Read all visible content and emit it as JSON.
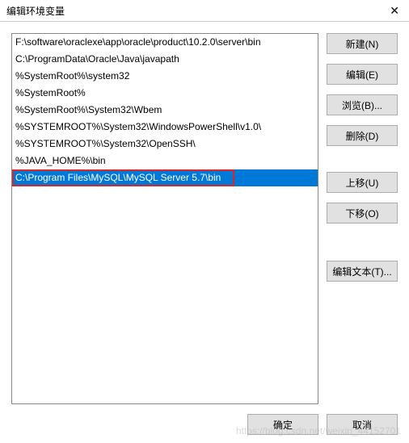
{
  "title": "编辑环境变量",
  "list": {
    "items": [
      "F:\\software\\oraclexe\\app\\oracle\\product\\10.2.0\\server\\bin",
      "C:\\ProgramData\\Oracle\\Java\\javapath",
      "%SystemRoot%\\system32",
      "%SystemRoot%",
      "%SystemRoot%\\System32\\Wbem",
      "%SYSTEMROOT%\\System32\\WindowsPowerShell\\v1.0\\",
      "%SYSTEMROOT%\\System32\\OpenSSH\\",
      "%JAVA_HOME%\\bin",
      "C:\\Program Files\\MySQL\\MySQL Server 5.7\\bin"
    ],
    "selected_index": 8,
    "highlighted_index": 8
  },
  "buttons": {
    "new": "新建(N)",
    "edit": "编辑(E)",
    "browse": "浏览(B)...",
    "delete": "删除(D)",
    "move_up": "上移(U)",
    "move_down": "下移(O)",
    "edit_text": "编辑文本(T)...",
    "ok": "确定",
    "cancel": "取消"
  },
  "watermark": "https://blog.csdn.net/weixin_44152701"
}
